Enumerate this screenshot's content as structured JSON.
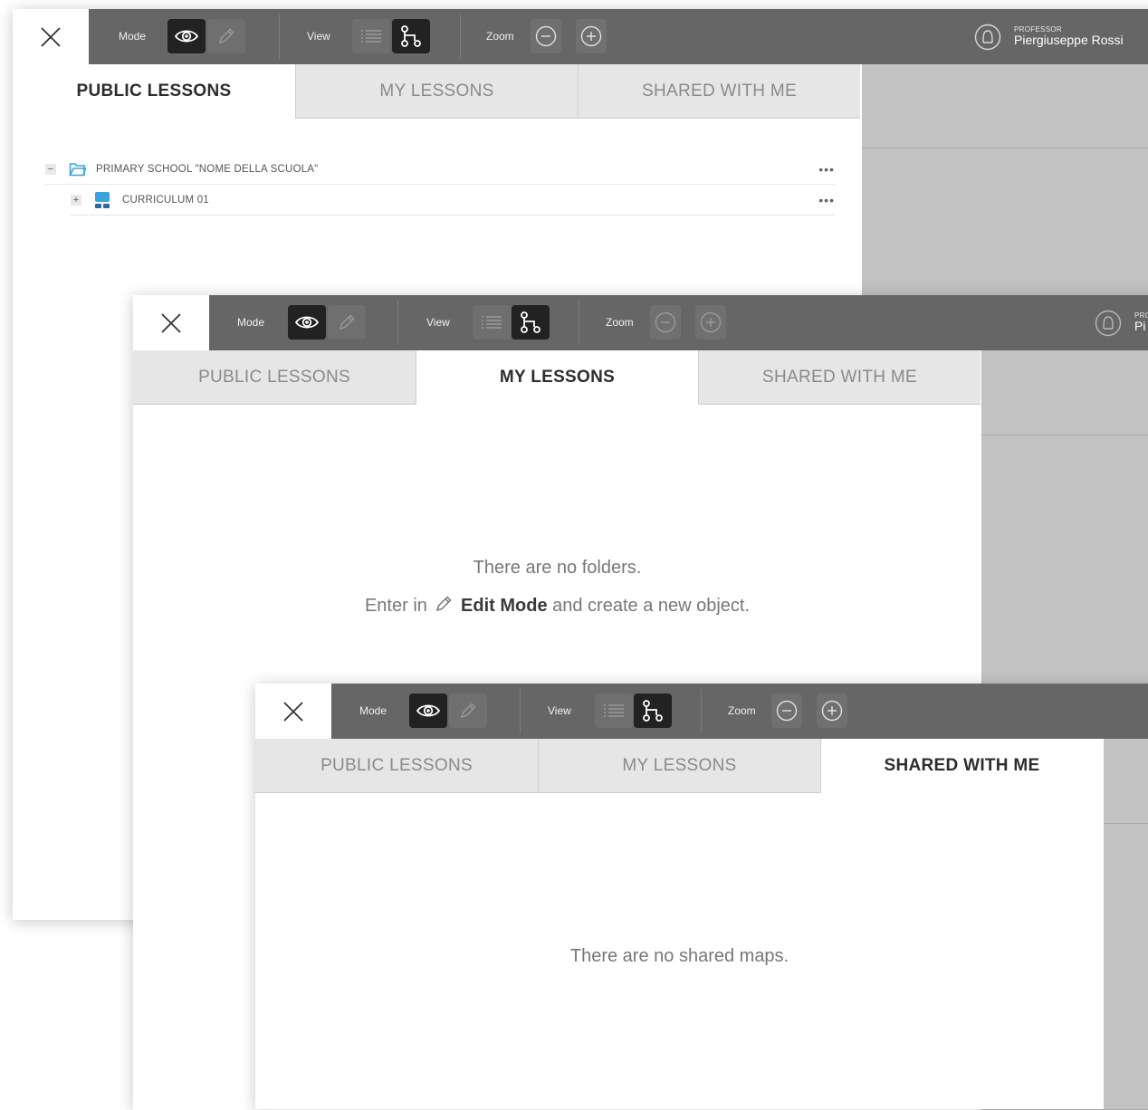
{
  "toolbar": {
    "mode_label": "Mode",
    "view_label": "View",
    "zoom_label": "Zoom",
    "close_icon": "close-icon",
    "view_mode_icon": "eye-icon",
    "edit_mode_icon": "pencil-icon",
    "list_view_icon": "list-icon",
    "map_view_icon": "map-tree-icon",
    "zoom_out_icon": "minus-circle-icon",
    "zoom_in_icon": "plus-circle-icon",
    "active_mode": "view",
    "active_view": "map"
  },
  "user": {
    "role": "PROFESSOR",
    "name": "Piergiuseppe Rossi",
    "role_partial": "PRO",
    "name_partial": "Pi"
  },
  "tabs": [
    "PUBLIC LESSONS",
    "MY LESSONS",
    "SHARED WITH ME"
  ],
  "public_lessons": {
    "tree": [
      {
        "toggle": "−",
        "icon": "folder-icon",
        "label": "PRIMARY SCHOOL \"NOME DELLA SCUOLA\"",
        "more": "•••"
      },
      {
        "toggle": "+",
        "icon": "curriculum-icon",
        "label": "CURRICULUM 01",
        "more": "•••"
      }
    ]
  },
  "my_lessons": {
    "empty_line1": "There are no folders.",
    "empty_prefix": "Enter in",
    "empty_bold": "Edit Mode",
    "empty_suffix": "and create a new object."
  },
  "shared_with_me": {
    "empty": "There are no shared maps."
  },
  "colors": {
    "toolbar_bg": "#666666",
    "active_button": "#222222",
    "tab_inactive_bg": "#e6e6e6",
    "folder_blue": "#3aa3dc",
    "curriculum_blue": "#3aa3dc"
  }
}
